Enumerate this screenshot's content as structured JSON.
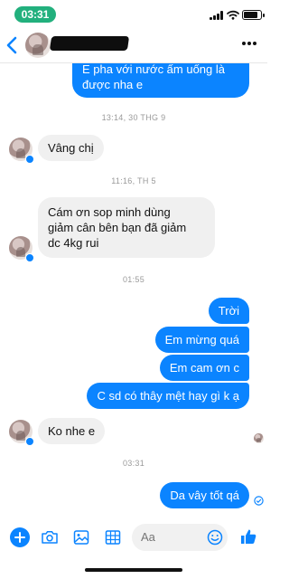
{
  "status_bar": {
    "time": "03:31"
  },
  "header": {
    "contact_name_redacted": true
  },
  "colors": {
    "accent": "#0b84ff",
    "incoming_bubble": "#f0f0f0",
    "time_pill": "#22b07d"
  },
  "messages": [
    {
      "dir": "out",
      "lines": [
        "E pha với nước ấm uống là",
        "được nha e"
      ]
    },
    {
      "ts": "13:14, 30 THG 9"
    },
    {
      "dir": "in",
      "lines": [
        "Vâng chị"
      ]
    },
    {
      "ts": "11:16, TH 5"
    },
    {
      "dir": "in",
      "lines": [
        "Cám ơn sop minh dùng",
        "giảm cân bên bạn đã giảm",
        "dc 4kg rui"
      ]
    },
    {
      "ts": "01:55"
    },
    {
      "dir": "out",
      "lines": [
        "Trời"
      ]
    },
    {
      "dir": "out",
      "lines": [
        "Em mừng quá"
      ]
    },
    {
      "dir": "out",
      "lines": [
        "Em cam ơn c"
      ]
    },
    {
      "dir": "out",
      "lines": [
        "C sd có thây mệt hay gì k ạ"
      ]
    },
    {
      "dir": "in",
      "lines": [
        "Ko nhe e"
      ]
    },
    {
      "ts": "03:31"
    },
    {
      "dir": "out",
      "lines": [
        "Da vây tốt qá"
      ]
    }
  ],
  "composer": {
    "placeholder": "Aa"
  },
  "icons": [
    "back-chevron-icon",
    "more-dots-icon",
    "add-icon",
    "camera-icon",
    "gallery-icon",
    "sticker-icon",
    "emoji-icon",
    "like-icon"
  ]
}
